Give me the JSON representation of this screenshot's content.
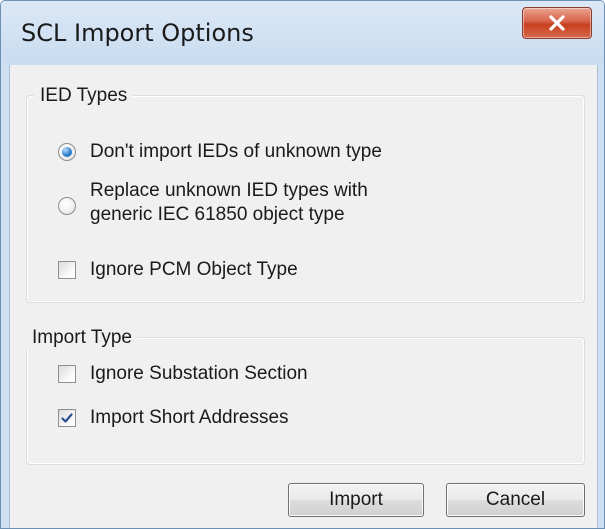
{
  "window": {
    "title": "SCL Import Options",
    "close_icon": "close-x-icon"
  },
  "ied_types": {
    "legend": "IED Types",
    "options": [
      {
        "label": "Don't import IEDs of unknown type",
        "selected": true
      },
      {
        "label_line1": "Replace unknown IED types with",
        "label_line2": "generic IEC 61850 object type",
        "selected": false
      }
    ],
    "ignore_pcm": {
      "label": "Ignore PCM Object Type",
      "checked": false
    }
  },
  "import_type": {
    "legend": "Import Type",
    "ignore_substation": {
      "label": "Ignore Substation Section",
      "checked": false
    },
    "import_short_addresses": {
      "label": "Import Short Addresses",
      "checked": true
    }
  },
  "buttons": {
    "import_label": "Import",
    "cancel_label": "Cancel"
  },
  "colors": {
    "accent": "#2f7fd0",
    "close_button": "#c7401e"
  }
}
